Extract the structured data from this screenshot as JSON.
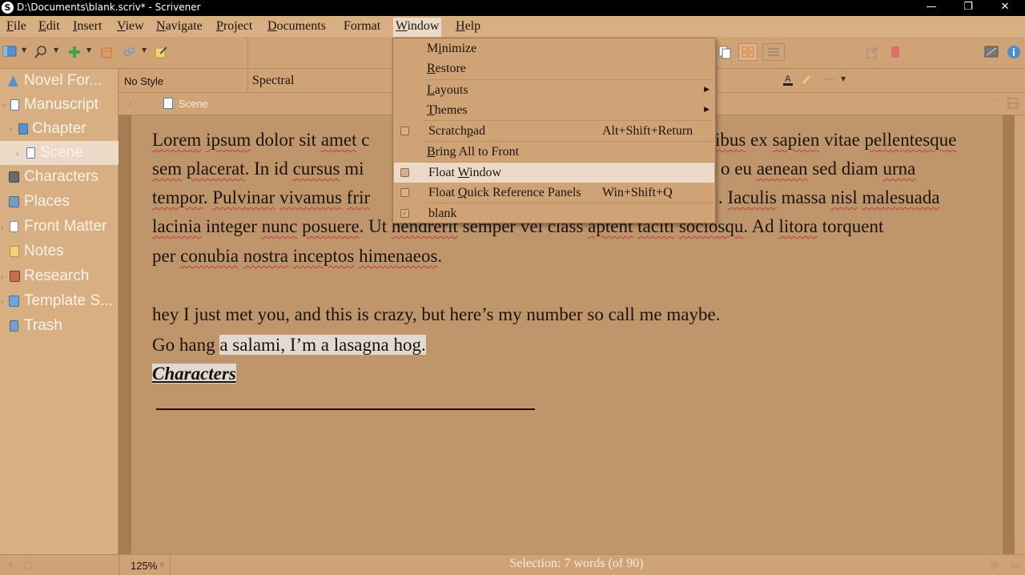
{
  "window": {
    "title": "D:\\Documents\\blank.scriv* - Scrivener",
    "app_icon": "S",
    "controls": [
      "—",
      "❐",
      "✕"
    ]
  },
  "menubar": [
    {
      "label_first": "F",
      "label_rest": "ile"
    },
    {
      "label_first": "E",
      "label_rest": "dit"
    },
    {
      "label_first": "I",
      "label_rest": "nsert"
    },
    {
      "label_first": "V",
      "label_rest": "iew"
    },
    {
      "label_first": "N",
      "label_rest": "avigate"
    },
    {
      "label_first": "P",
      "label_rest": "roject"
    },
    {
      "label_first": "D",
      "label_rest": "ocuments"
    },
    {
      "label_first": "F",
      "label_rest": "ormat",
      "first_plain": true
    },
    {
      "label_first": "W",
      "label_rest": "indow"
    },
    {
      "label_first": "H",
      "label_rest": "elp"
    }
  ],
  "formatbar": {
    "style": "No Style",
    "font": "Spectral"
  },
  "header": {
    "doc_title": "Scene"
  },
  "binder": [
    {
      "label": "Novel For...",
      "icon": "novel-icon",
      "color": "#5a8fc8"
    },
    {
      "label": "Manuscript",
      "icon": "manuscript-icon",
      "color": "#ffffff"
    },
    {
      "label": "Chapter",
      "icon": "chapter-folder-icon",
      "color": "#5a8fc8"
    },
    {
      "label": "Scene",
      "icon": "scene-document-icon",
      "color": "#ffffff"
    },
    {
      "label": "Characters",
      "icon": "characters-icon",
      "color": "#6a6a6a"
    },
    {
      "label": "Places",
      "icon": "places-icon",
      "color": "#7a9ac0"
    },
    {
      "label": "Front Matter",
      "icon": "front-matter-icon",
      "color": "#ffffff"
    },
    {
      "label": "Notes",
      "icon": "notes-icon",
      "color": "#f1d27a"
    },
    {
      "label": "Research",
      "icon": "research-icon",
      "color": "#c0704a"
    },
    {
      "label": "Template S...",
      "icon": "template-sheets-icon",
      "color": "#6aa6d8"
    },
    {
      "label": "Trash",
      "icon": "trash-icon",
      "color": "#7aa0c8"
    }
  ],
  "editor": {
    "p1_l1": [
      "Lorem",
      " ",
      "ipsum",
      " dolor sit ",
      "amet",
      " c"
    ],
    "p1_l1_tail": [
      "ibus",
      " ex ",
      "sapien",
      " vitae ",
      "pellentesque"
    ],
    "p1_l2": [
      "sem",
      " ",
      "placerat",
      ". In id ",
      "cursus",
      " mi"
    ],
    "p1_l2_tail": [
      "o eu ",
      "aenean",
      " sed diam ",
      "urna"
    ],
    "p1_l3": [
      "tempor",
      ". ",
      "Pulvinar",
      " ",
      "vivamus",
      " ",
      "frir"
    ],
    "p1_l3_tail": [
      ". ",
      "Iaculis",
      " massa ",
      "nisl",
      " ",
      "malesuada"
    ],
    "p1_l4": [
      "lacinia",
      " integer ",
      "nunc",
      " ",
      "posuere",
      ". Ut ",
      "hendrerit",
      " semper vel class ",
      "aptent",
      " ",
      "taciti",
      " ",
      "sociosqu",
      ". Ad ",
      "litora",
      " torquent"
    ],
    "p1_l5": [
      "per ",
      "conubia",
      " ",
      "nostra",
      " ",
      "inceptos",
      " ",
      "himenaeos",
      "."
    ],
    "p2_l1": "hey I just met you, and this is crazy, but here’s my number so call me maybe.",
    "p2_l2_a": "Go hang ",
    "p2_l2_b": "a salami, I’m a lasagna hog.",
    "heading": "Characters"
  },
  "footer": {
    "zoom": "125%",
    "selection": "Selection: 7 words (of 90)"
  },
  "window_menu": {
    "items": [
      {
        "pre": "M",
        "u": "i",
        "post": "nimize"
      },
      {
        "pre": "",
        "u": "R",
        "post": "estore"
      },
      {
        "pre": "",
        "u": "L",
        "post": "ayouts",
        "arrow": "▶"
      },
      {
        "pre": "",
        "u": "T",
        "post": "hemes",
        "arrow": "▶"
      },
      {
        "pre": "Scratch",
        "u": "p",
        "post": "ad",
        "shortcut": "Alt+Shift+Return",
        "checkbox": true
      },
      {
        "pre": "",
        "u": "B",
        "post": "ring All to Front"
      },
      {
        "pre": "Float ",
        "u": "W",
        "post": "indow",
        "checkbox": true
      },
      {
        "pre": "Float ",
        "u": "Q",
        "post": "uick Reference Panels",
        "shortcut": "Win+Shift+Q",
        "checkbox": true
      },
      {
        "pre": "blank",
        "u": "",
        "post": "",
        "checkbox": true,
        "checked": "✓"
      }
    ]
  },
  "colors": {
    "accent_highlight": "#ecd9c8",
    "editor_bg": "#bf956b",
    "chrome_bg": "#cfa375"
  }
}
